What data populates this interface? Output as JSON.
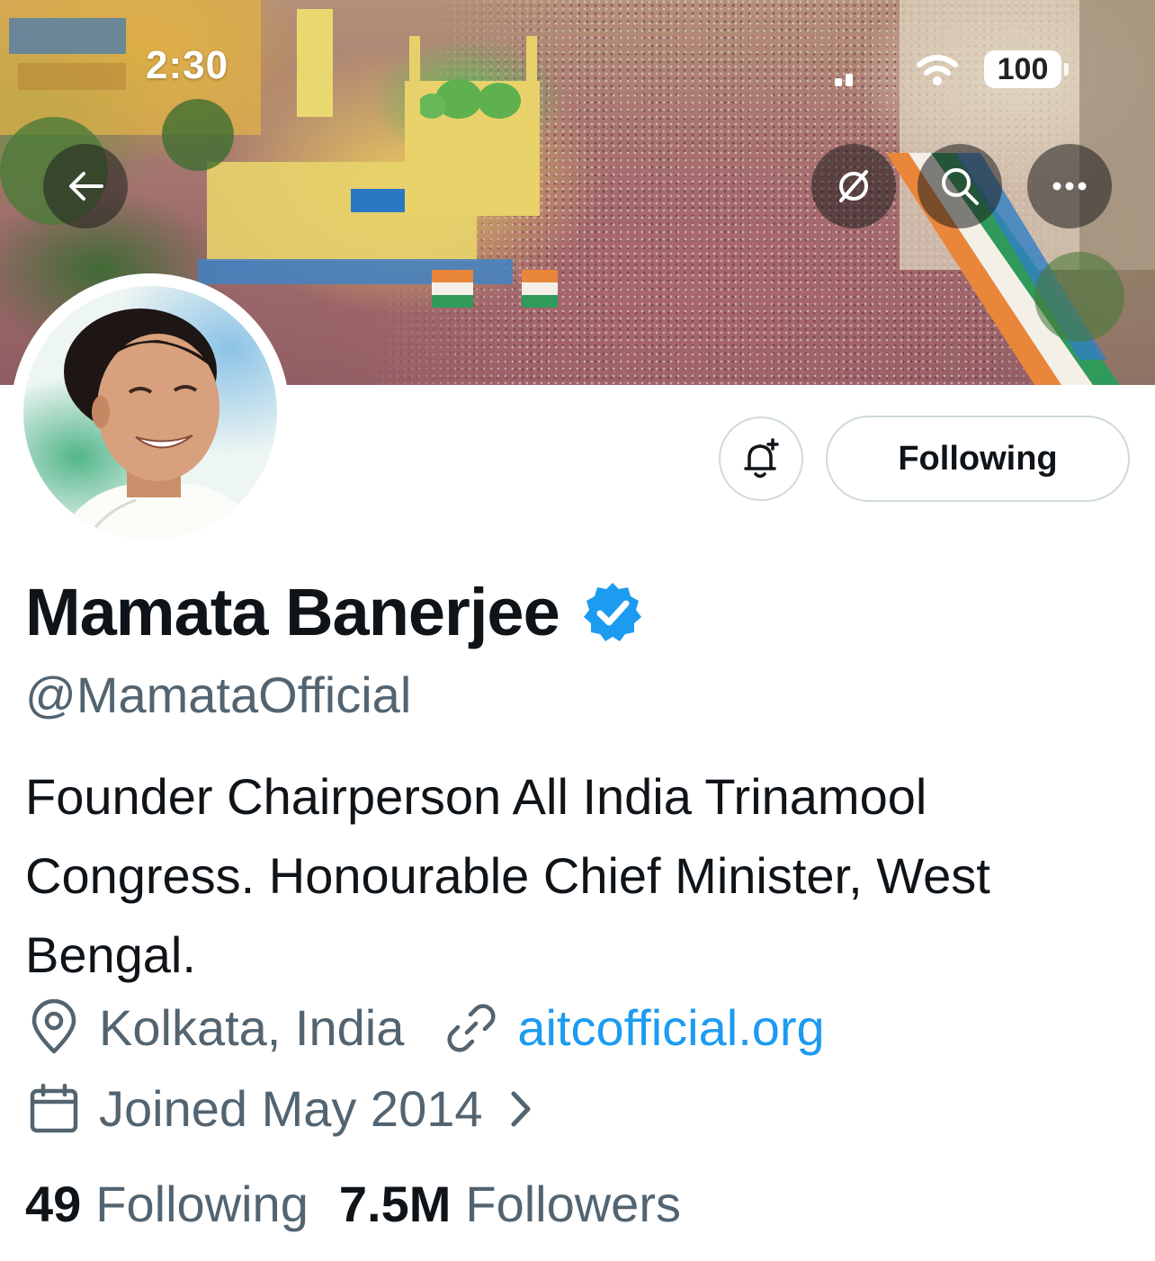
{
  "status_bar": {
    "time": "2:30",
    "battery": "100"
  },
  "header": {
    "back_icon": "arrow-left-icon",
    "actions": [
      "refresh-off-icon",
      "search-icon",
      "more-icon"
    ]
  },
  "profile": {
    "display_name": "Mamata Banerjee",
    "verified": true,
    "handle": "@MamataOfficial",
    "bio": "Founder Chairperson All India Trinamool Congress. Honourable Chief Minister, West Bengal.",
    "location": "Kolkata, India",
    "website": "aitcofficial.org",
    "joined": "Joined May 2014",
    "following_count": "49",
    "following_label": "Following",
    "followers_count": "7.5M",
    "followers_label": "Followers"
  },
  "buttons": {
    "notify_icon": "bell-plus-icon",
    "follow_state": "Following"
  },
  "colors": {
    "accent": "#1d9bf0",
    "text_primary": "#0f1419",
    "text_secondary": "#536471",
    "border": "#cfd9de"
  }
}
